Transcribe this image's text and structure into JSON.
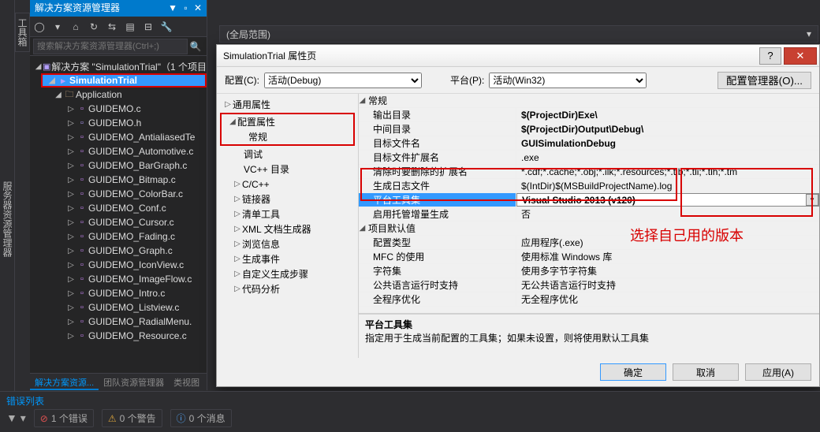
{
  "side": {
    "server": "服务器资源管理器",
    "tool": "工具箱"
  },
  "solution_panel": {
    "title": "解决方案资源管理器",
    "search_placeholder": "搜索解决方案资源管理器(Ctrl+;)",
    "solution_label": "解决方案 \"SimulationTrial\"（1 个项目",
    "project": "SimulationTrial",
    "folder": "Application",
    "files": [
      "GUIDEMO.c",
      "GUIDEMO.h",
      "GUIDEMO_AntialiasedTe",
      "GUIDEMO_Automotive.c",
      "GUIDEMO_BarGraph.c",
      "GUIDEMO_Bitmap.c",
      "GUIDEMO_ColorBar.c",
      "GUIDEMO_Conf.c",
      "GUIDEMO_Cursor.c",
      "GUIDEMO_Fading.c",
      "GUIDEMO_Graph.c",
      "GUIDEMO_IconView.c",
      "GUIDEMO_ImageFlow.c",
      "GUIDEMO_Intro.c",
      "GUIDEMO_Listview.c",
      "GUIDEMO_RadialMenu.",
      "GUIDEMO_Resource.c"
    ],
    "tabs": [
      "解决方案资源...",
      "团队资源管理器",
      "类视图"
    ]
  },
  "scope": {
    "label": "(全局范围)"
  },
  "dialog": {
    "title": "SimulationTrial 属性页",
    "config_label": "配置(C):",
    "config_value": "活动(Debug)",
    "platform_label": "平台(P):",
    "platform_value": "活动(Win32)",
    "config_mgr": "配置管理器(O)...",
    "nav": {
      "common": "通用属性",
      "cfg_props": "配置属性",
      "general": "常规",
      "debug": "调试",
      "vcdir": "VC++ 目录",
      "ccpp": "C/C++",
      "linker": "链接器",
      "manifest": "清单工具",
      "xmldoc": "XML 文档生成器",
      "browse": "浏览信息",
      "build": "生成事件",
      "custom": "自定义生成步骤",
      "analysis": "代码分析"
    },
    "grid": {
      "sections": [
        "常规",
        "项目默认值"
      ],
      "r1": {
        "k": "输出目录",
        "v": "$(ProjectDir)Exe\\"
      },
      "r2": {
        "k": "中间目录",
        "v": "$(ProjectDir)Output\\Debug\\"
      },
      "r3": {
        "k": "目标文件名",
        "v": "GUISimulationDebug"
      },
      "r4": {
        "k": "目标文件扩展名",
        "v": ".exe"
      },
      "r5": {
        "k": "清除时要删除的扩展名",
        "v": "*.cdf;*.cache;*.obj;*.ilk;*.resources;*.tlb;*.tli;*.tlh;*.tm"
      },
      "r6": {
        "k": "生成日志文件",
        "v": "$(IntDir)$(MSBuildProjectName).log"
      },
      "r7": {
        "k": "平台工具集",
        "v": "Visual Studio 2013 (v120)"
      },
      "r8": {
        "k": "启用托管增量生成",
        "v": "否"
      },
      "r9": {
        "k": "配置类型",
        "v": "应用程序(.exe)"
      },
      "r10": {
        "k": "MFC 的使用",
        "v": "使用标准 Windows 库"
      },
      "r11": {
        "k": "字符集",
        "v": "使用多字节字符集"
      },
      "r12": {
        "k": "公共语言运行时支持",
        "v": "无公共语言运行时支持"
      },
      "r13": {
        "k": "全程序优化",
        "v": "无全程序优化"
      }
    },
    "desc": {
      "h": "平台工具集",
      "t": "指定用于生成当前配置的工具集；如果未设置，则将使用默认工具集"
    },
    "buttons": {
      "ok": "确定",
      "cancel": "取消",
      "apply": "应用(A)"
    },
    "annotation": "选择自己用的版本"
  },
  "errors": {
    "title": "错误列表",
    "err": "1 个错误",
    "warn": "0 个警告",
    "msg": "0 个消息"
  }
}
